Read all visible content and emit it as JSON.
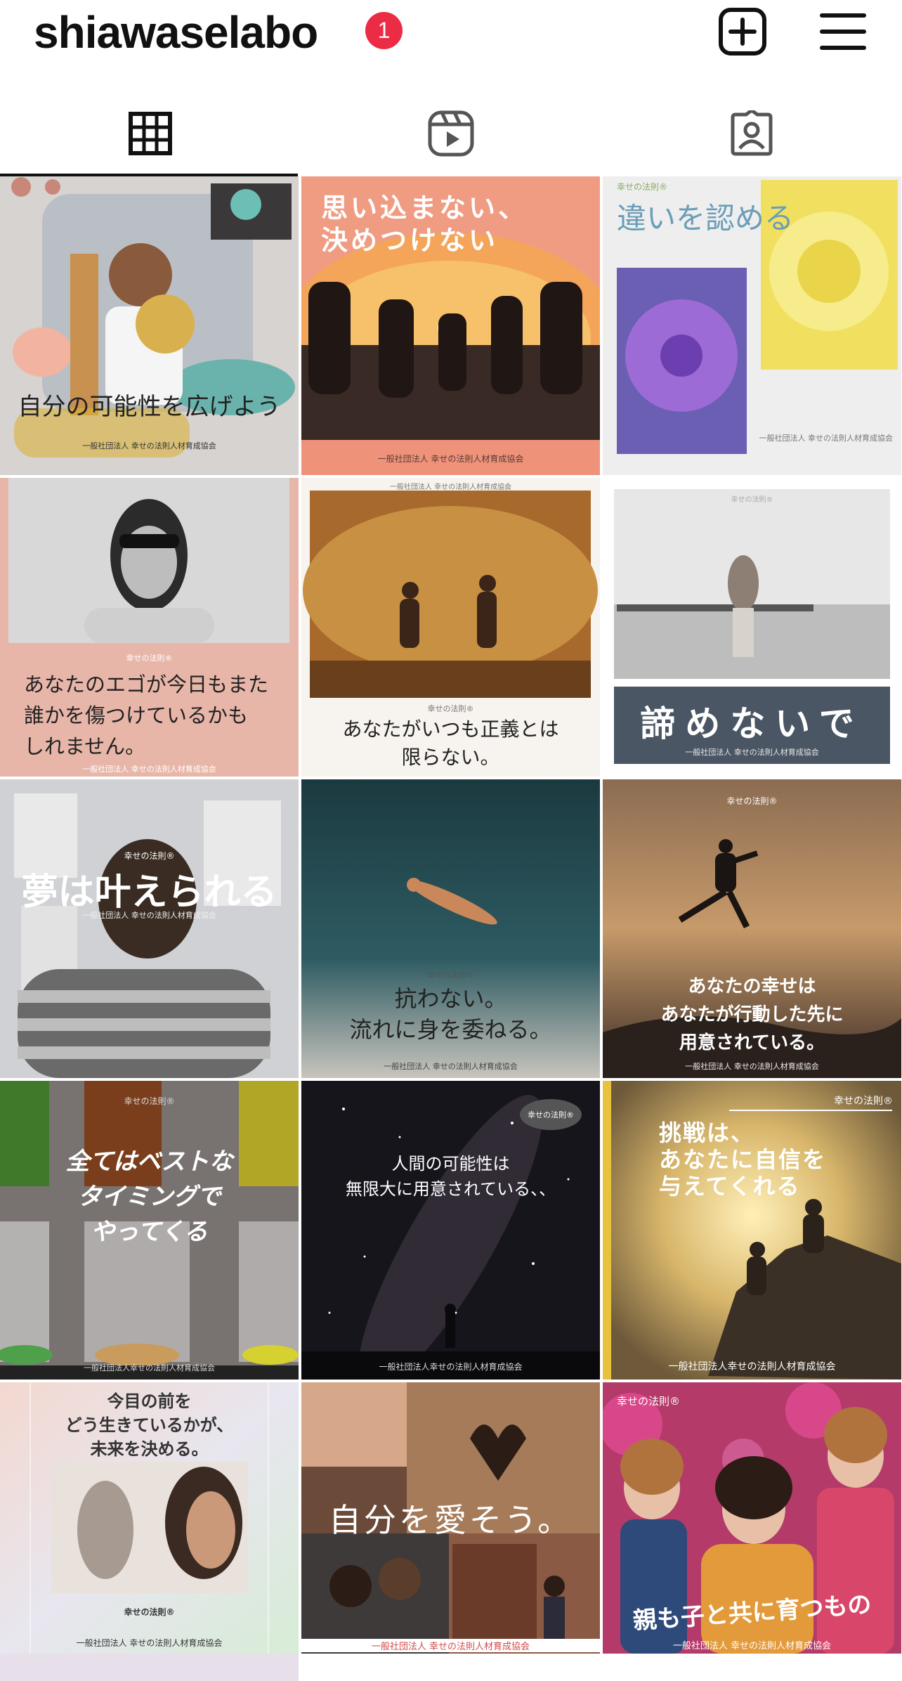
{
  "header": {
    "username": "shiawaselabo",
    "notification_count": "1",
    "icons": [
      "new-post-icon",
      "menu-icon"
    ]
  },
  "tabs": [
    {
      "name": "posts-grid",
      "icon": "grid-icon",
      "active": true
    },
    {
      "name": "reels",
      "icon": "reels-icon",
      "active": false
    },
    {
      "name": "tagged",
      "icon": "tagged-icon",
      "active": false
    }
  ],
  "colors": {
    "badge": "#ec2b45",
    "text": "#111111"
  },
  "posts": [
    {
      "title": "自分の可能性を広げよう",
      "org": "一般社団法人 幸せの法則人材育成協会"
    },
    {
      "title_line1": "思い込まない、",
      "title_line2": "決めつけない",
      "org": "一般社団法人 幸せの法則人材育成協会"
    },
    {
      "brand": "幸せの法則®",
      "title": "違いを認める",
      "org": "一般社団法人 幸せの法則人材育成協会"
    },
    {
      "brand": "幸せの法則®",
      "title_line1": "あなたのエゴが今日もまた",
      "title_line2": "誰かを傷つけているかも",
      "title_line3": "しれません。",
      "org": "一般社団法人 幸せの法則人材育成協会"
    },
    {
      "org_top": "一般社団法人 幸せの法則人材育成協会",
      "brand": "幸せの法則®",
      "title_line1": "あなたがいつも正義とは",
      "title_line2": "限らない。"
    },
    {
      "brand": "幸せの法則®",
      "title": "諦めないで",
      "org": "一般社団法人 幸せの法則人材育成協会"
    },
    {
      "brand": "幸せの法則®",
      "title": "夢は叶えられる",
      "org": "一般社団法人 幸せの法則人材育成協会"
    },
    {
      "brand": "幸せの法則®",
      "title_line1": "抗わない。",
      "title_line2": "流れに身を委ねる。",
      "org": "一般社団法人 幸せの法則人材育成協会"
    },
    {
      "brand": "幸せの法則®",
      "title_line1": "あなたの幸せは",
      "title_line2": "あなたが行動した先に",
      "title_line3": "用意されている。",
      "org": "一般社団法人 幸せの法則人材育成協会"
    },
    {
      "brand": "幸せの法則®",
      "title_line1": "全てはベストな",
      "title_line2": "タイミングで",
      "title_line3": "やってくる",
      "org": "一般社団法人幸せの法則人材育成協会"
    },
    {
      "brand": "幸せの法則®",
      "title_line1": "人間の可能性は",
      "title_line2": "無限大に用意されている、、",
      "org": "一般社団法人幸せの法則人材育成協会"
    },
    {
      "brand": "幸せの法則®",
      "title_line1": "挑戦は、",
      "title_line2": "あなたに自信を",
      "title_line3": "与えてくれる",
      "org": "一般社団法人幸せの法則人材育成協会"
    },
    {
      "title_line1": "今目の前を",
      "title_line2": "どう生きているかが、",
      "title_line3": "未来を決める。",
      "brand": "幸せの法則®",
      "org": "一般社団法人 幸せの法則人材育成協会"
    },
    {
      "title": "自分を愛そう。",
      "org": "一般社団法人 幸せの法則人材育成協会"
    },
    {
      "brand": "幸せの法則®",
      "title": "親も子と共に育つもの",
      "org": "一般社団法人 幸せの法則人材育成協会"
    }
  ]
}
